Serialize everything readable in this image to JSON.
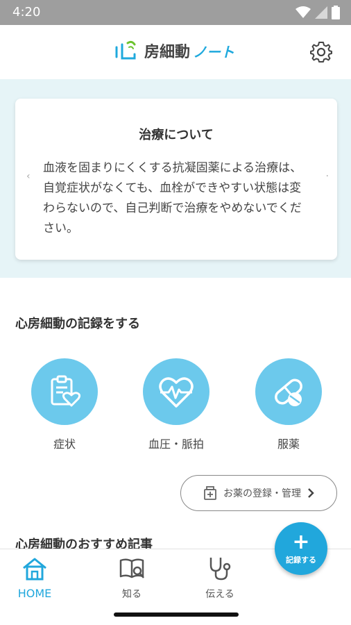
{
  "status_bar": {
    "time": "4:20"
  },
  "header": {
    "logo_text": "房細動",
    "logo_suffix": "ノート",
    "settings_icon": "gear-icon"
  },
  "banner": {
    "title": "治療について",
    "body": "血液を固まりにくくする抗凝固薬による治療は、自覚症状がなくても、血栓ができやすい状態は変わらないので、自己判断で治療をやめないでください。",
    "prev_icon": "chevron-left-icon",
    "next_icon": "chevron-right-icon"
  },
  "record_section": {
    "title": "心房細動の記録をする",
    "items": [
      {
        "label": "症状",
        "icon": "clipboard-heart-icon"
      },
      {
        "label": "血圧・脈拍",
        "icon": "heart-pulse-icon"
      },
      {
        "label": "服薬",
        "icon": "pill-icon"
      }
    ]
  },
  "manage_button": {
    "label": "お薬の登録・管理"
  },
  "articles": {
    "title": "心房細動のおすすめ記事"
  },
  "fab": {
    "plus": "+",
    "label": "記録する"
  },
  "bottom_nav": {
    "items": [
      {
        "label": "HOME",
        "icon": "home-icon",
        "active": true
      },
      {
        "label": "知る",
        "icon": "book-search-icon"
      },
      {
        "label": "伝える",
        "icon": "stethoscope-icon"
      }
    ]
  },
  "colors": {
    "accent": "#21a7dc",
    "circle": "#6cc9ec",
    "banner_bg": "#e6f4f7"
  }
}
